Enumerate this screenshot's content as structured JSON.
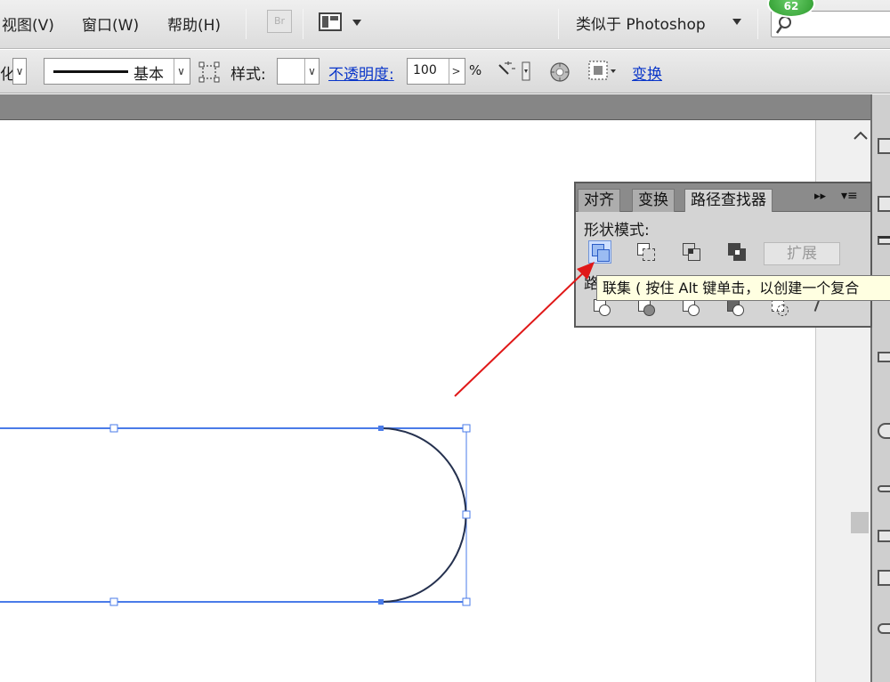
{
  "menubar": {
    "items": [
      "视图(V)",
      "窗口(W)",
      "帮助(H)"
    ],
    "bridge_label": "Br",
    "workspace_label": "类似于 Photoshop",
    "notification_count": "62"
  },
  "controlbar": {
    "edge_label": "化",
    "stroke_profile_label": "基本",
    "style_label": "样式:",
    "opacity_label": "不透明度:",
    "opacity_value": "100",
    "opacity_unit": "%",
    "transform_link": "变换"
  },
  "panel": {
    "tabs": [
      "对齐",
      "变换",
      "路径查找器"
    ],
    "shape_modes_label": "形状模式:",
    "expand_label": "扩展",
    "pathfinders_label_partial": "路",
    "tooltip": "联集 ( 按住 Alt 键单击，以创建一个复合"
  },
  "colors": {
    "selection_blue": "#4a7be8",
    "annotation_red": "#e01818",
    "tooltip_bg": "#ffffe1",
    "link_blue": "#0a36c9"
  }
}
